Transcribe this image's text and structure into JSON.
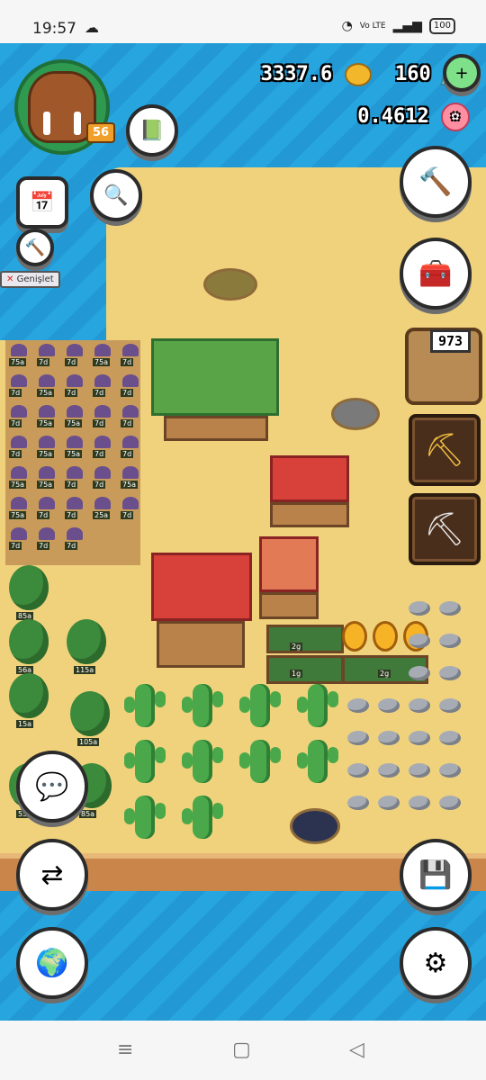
{
  "status_bar": {
    "time": "19:57",
    "network": "Vo LTE",
    "battery": "100"
  },
  "hud": {
    "coins": "3337.6",
    "gems": "160",
    "flowers": "0.4612",
    "level": "56",
    "expand_label": "Genişlet",
    "inventory_count": "973"
  },
  "farm": {
    "crop_labels": [
      "75a",
      "7d",
      "7d",
      "75a",
      "7d",
      "7d",
      "75a",
      "7d",
      "7d",
      "7d",
      "7d",
      "75a",
      "75a",
      "7d",
      "7d",
      "7d",
      "75a",
      "75a",
      "7d",
      "7d",
      "75a",
      "75a",
      "7d",
      "7d",
      "75a",
      "75a",
      "7d",
      "7d",
      "25a",
      "7d",
      "7d",
      "7d",
      "7d"
    ],
    "tree_labels": [
      "85a",
      "56a",
      "115a",
      "15a",
      "105a",
      "55a",
      "85a"
    ],
    "plot_labels": [
      "2g",
      "1g",
      "2g"
    ]
  },
  "icons": {
    "add_gems": "plus-icon",
    "build": "hammer-icon",
    "inventory": "toolbox-icon",
    "pickaxe_gold": "golden-pickaxe-icon",
    "pickaxe": "pickaxe-icon",
    "chat": "chat-icon",
    "swap": "swap-arrows-icon",
    "save": "save-icon",
    "world": "globe-icon",
    "settings": "gear-icon",
    "calendar": "calendar-icon",
    "search": "magnifier-icon",
    "book": "book-clock-icon"
  },
  "colors": {
    "water": "#1e9bd6",
    "sand": "#f0d27c",
    "grass_roof": "#58a447",
    "red_roof": "#d8413a"
  }
}
